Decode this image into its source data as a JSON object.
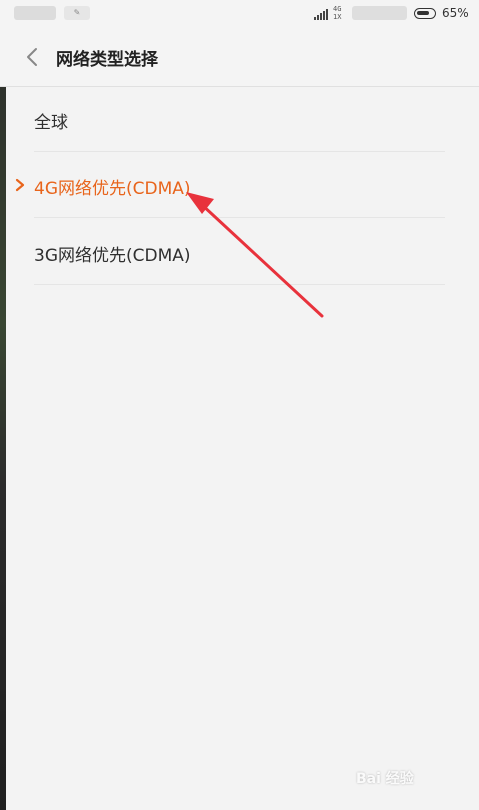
{
  "status_bar": {
    "network_top": "4G",
    "network_bottom": "1X",
    "battery_percent": "65%",
    "battery_level": 0.65
  },
  "header": {
    "title": "网络类型选择"
  },
  "network_options": [
    {
      "label": "全球",
      "selected": false
    },
    {
      "label": "4G网络优先(CDMA)",
      "selected": true
    },
    {
      "label": "3G网络优先(CDMA)",
      "selected": false
    }
  ],
  "colors": {
    "selected_text": "#e8641b",
    "annotation_arrow": "#e8323c"
  },
  "watermark": {
    "text": "Bai 经验"
  }
}
